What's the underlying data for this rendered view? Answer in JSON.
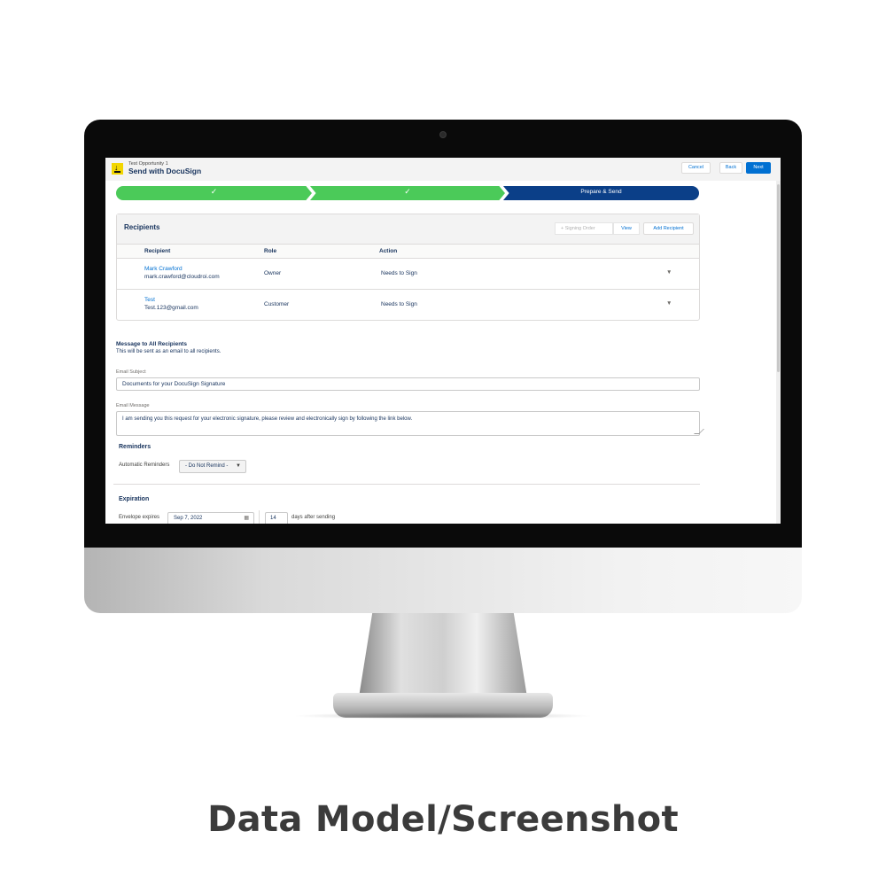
{
  "caption": "Data Model/Screenshot",
  "header": {
    "subtitle": "Test Opportunity 1",
    "title": "Send with DocuSign",
    "cancel_label": "Cancel",
    "back_label": "Back",
    "next_label": "Next",
    "brand_color": "#0070d2"
  },
  "progress": {
    "steps": [
      {
        "label": "✓",
        "status": "complete",
        "color": "#4bca59"
      },
      {
        "label": "✓",
        "status": "complete",
        "color": "#4bca59"
      },
      {
        "label": "Prepare & Send",
        "status": "current",
        "color": "#0b3f88"
      }
    ]
  },
  "recipients": {
    "title": "Recipients",
    "signing_order_label": "Signing Order",
    "view_label": "View",
    "add_label": "Add Recipient",
    "columns": [
      "Recipient",
      "Role",
      "Action"
    ],
    "rows": [
      {
        "name": "Mark Crawford",
        "email": "mark.crawford@cloudroi.com",
        "role": "Owner",
        "action": "Needs to Sign"
      },
      {
        "name": "Test",
        "email": "Test.123@gmail.com",
        "role": "Customer",
        "action": "Needs to Sign"
      }
    ]
  },
  "message": {
    "title": "Message to All Recipients",
    "subtitle": "This will be sent as an email to all recipients.",
    "subject_label": "Email Subject",
    "subject_value": "Documents for your DocuSign Signature",
    "message_label": "Email Message",
    "message_value": "I am sending you this request for your electronic signature, please review and electronically sign by following the link below."
  },
  "reminders": {
    "title": "Reminders",
    "label": "Automatic Reminders",
    "selected": "- Do Not Remind -"
  },
  "expiration": {
    "title": "Expiration",
    "label": "Envelope expires",
    "date": "Sep 7, 2022",
    "days": "14",
    "days_label": "days after sending"
  }
}
